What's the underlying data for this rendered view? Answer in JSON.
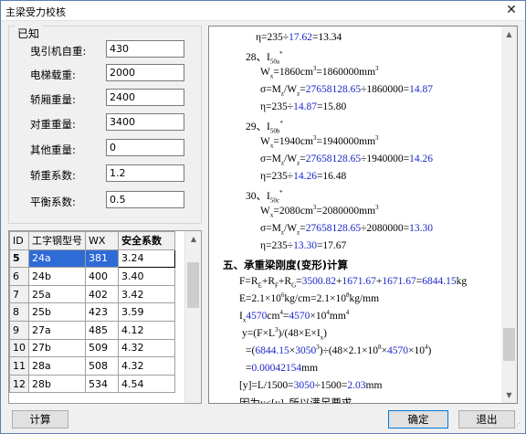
{
  "window": {
    "title": "主梁受力校核",
    "close_glyph": "✕"
  },
  "known_group": {
    "label": "已知",
    "fields": [
      {
        "label": "曳引机自重:",
        "value": "430"
      },
      {
        "label": "电梯载重:",
        "value": "2000"
      },
      {
        "label": "轿厢重量:",
        "value": "2400"
      },
      {
        "label": "对重重量:",
        "value": "3400"
      },
      {
        "label": "其他重量:",
        "value": "0"
      },
      {
        "label": "轿重系数:",
        "value": "1.2"
      },
      {
        "label": "平衡系数:",
        "value": "0.5"
      }
    ]
  },
  "grid": {
    "columns": [
      "ID",
      "工字钢型号",
      "WX",
      "安全系数"
    ],
    "rows": [
      {
        "id": "5",
        "model": "24a",
        "wx": "381",
        "sf": "3.24"
      },
      {
        "id": "6",
        "model": "24b",
        "wx": "400",
        "sf": "3.40"
      },
      {
        "id": "7",
        "model": "25a",
        "wx": "402",
        "sf": "3.42"
      },
      {
        "id": "8",
        "model": "25b",
        "wx": "423",
        "sf": "3.59"
      },
      {
        "id": "9",
        "model": "27a",
        "wx": "485",
        "sf": "4.12"
      },
      {
        "id": "10",
        "model": "27b",
        "wx": "509",
        "sf": "4.32"
      },
      {
        "id": "11",
        "model": "28a",
        "wx": "508",
        "sf": "4.32"
      },
      {
        "id": "12",
        "model": "28b",
        "wx": "534",
        "sf": "4.54"
      }
    ],
    "selected_index": 0,
    "up_arrow": "▲"
  },
  "calc": {
    "l01_a": "η=235÷",
    "l01_b": "17.62",
    "l01_c": "=13.34",
    "l02_a": "28、I",
    "l02_sub": "50a",
    "l02_sup": "*",
    "l03_a": "W",
    "l03_sub": "x",
    "l03_b": "=1860cm",
    "l03_sup1": "3",
    "l03_c": "=1860000mm",
    "l03_sup2": "3",
    "l04_a": "σ=M",
    "l04_sub1": "z",
    "l04_b": "/W",
    "l04_sub2": "z",
    "l04_c": "=",
    "l04_d": "27658128.65",
    "l04_e": "÷1860000=",
    "l04_f": "14.87",
    "l05_a": "η=235÷",
    "l05_b": "14.87",
    "l05_c": "=15.80",
    "l06_a": "29、I",
    "l06_sub": "50b",
    "l06_sup": "*",
    "l07_a": "W",
    "l07_sub": "x",
    "l07_b": "=1940cm",
    "l07_sup1": "3",
    "l07_c": "=1940000mm",
    "l07_sup2": "3",
    "l08_a": "σ=M",
    "l08_sub1": "z",
    "l08_b": "/W",
    "l08_sub2": "z",
    "l08_c": "=",
    "l08_d": "27658128.65",
    "l08_e": "÷1940000=",
    "l08_f": "14.26",
    "l09_a": "η=235÷",
    "l09_b": "14.26",
    "l09_c": "=16.48",
    "l10_a": "30、I",
    "l10_sub": "50c",
    "l10_sup": "*",
    "l11_a": "W",
    "l11_sub": "x",
    "l11_b": "=2080cm",
    "l11_sup1": "3",
    "l11_c": "=2080000mm",
    "l11_sup2": "3",
    "l12_a": "σ=M",
    "l12_sub1": "z",
    "l12_b": "/W",
    "l12_sub2": "z",
    "l12_c": "=",
    "l12_d": "27658128.65",
    "l12_e": "÷2080000=",
    "l12_f": "13.30",
    "l13_a": "η=235÷",
    "l13_b": "13.30",
    "l13_c": "=17.67",
    "l14": "五、承重梁刚度(变形)计算",
    "l15_a": "F=R",
    "l15_sub1": "E",
    "l15_b": "+R",
    "l15_sub2": "F",
    "l15_c": "+R",
    "l15_sub3": "G",
    "l15_d": "=",
    "l15_e": "3500.82",
    "l15_f": "+",
    "l15_g": "1671.67",
    "l15_h": "+",
    "l15_i": "1671.67",
    "l15_j": "=",
    "l15_k": "6844.15",
    "l15_l": "kg",
    "l16_a": "E=2.1×10",
    "l16_sup1": "6",
    "l16_b": "kg/cm=2.1×10",
    "l16_sup2": "8",
    "l16_c": "kg/mm",
    "l17_a": "I",
    "l17_sub": "x",
    "l17_b": "4570",
    "l17_c": "cm",
    "l17_sup1": "4",
    "l17_d": "=",
    "l17_e": "4570",
    "l17_f": "×10",
    "l17_sup2": "4",
    "l17_g": "mm",
    "l17_sup3": "4",
    "l18_a": "y=(F×L",
    "l18_sup": "3",
    "l18_b": ")/(48×E×I",
    "l18_sub": "x",
    "l18_c": ")",
    "l19_a": "=(",
    "l19_b": "6844.15",
    "l19_c": "×",
    "l19_d": "3050",
    "l19_sup1": "3",
    "l19_e": ")÷(48×2.1×10",
    "l19_sup2": "8",
    "l19_f": "×",
    "l19_g": "4570",
    "l19_h": "×10",
    "l19_sup3": "4",
    "l19_i": ")",
    "l20_a": "=",
    "l20_b": "0.00042154",
    "l20_c": "mm",
    "l21_a": "[y]=L/1500=",
    "l21_b": "3050",
    "l21_c": "÷1500=",
    "l21_d": "2.03",
    "l21_e": "mm",
    "l22": "因为y<[y], 所以满足要求。",
    "up_arrow": "▲",
    "down_arrow": "▼"
  },
  "buttons": {
    "compute": "计算",
    "ok": "确定",
    "exit": "退出"
  },
  "colors": {
    "value_blue": "#1a26c8",
    "selection": "#2f6bd6"
  }
}
